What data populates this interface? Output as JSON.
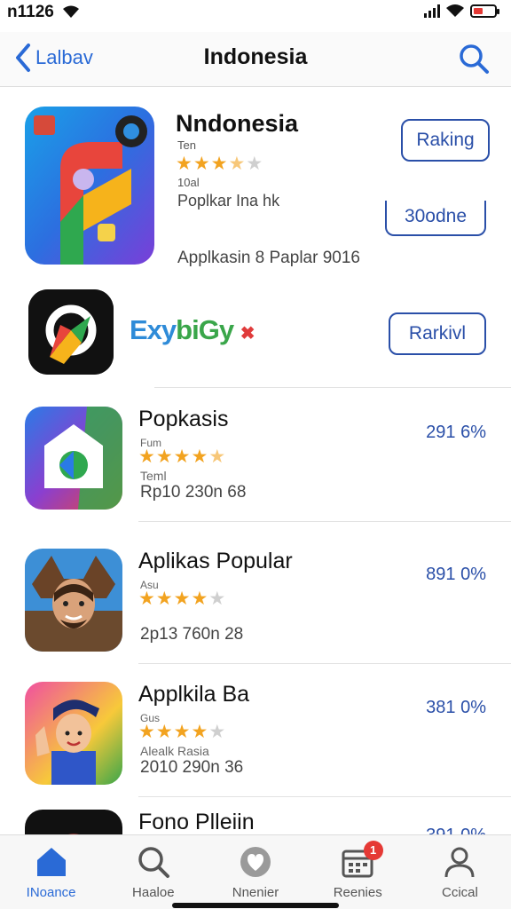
{
  "status_bar": {
    "time": "n1126"
  },
  "nav": {
    "back_label": "Lalbav",
    "title": "Indonesia"
  },
  "featured": {
    "title": "Nndonesia",
    "sub1": "Ten",
    "rating": 3.5,
    "sub2": "10al",
    "description": "Poplkar Ina hk",
    "caption": "Applkasin 8 Paplar 9016",
    "button1": "Raking",
    "button2": "30odne"
  },
  "promo": {
    "logo_part1": "Exy",
    "logo_part2": "biGy",
    "logo_mark": "✖",
    "button": "Rarkivl"
  },
  "list": [
    {
      "title": "Popkasis",
      "sub1": "Fum",
      "rating": 4.5,
      "sub2": "Teml",
      "meta": "Rp10 230n 68",
      "value": "291 6%"
    },
    {
      "title": "Aplikas Popular",
      "sub1": "Asu",
      "rating": 4,
      "sub2": "",
      "meta": "2p13 760n 28",
      "value": "891 0%"
    },
    {
      "title": "Applkila Ba",
      "sub1": "Gus",
      "rating": 4,
      "sub2": "Alealk Rasia",
      "meta": "2010 290n 36",
      "value": "381 0%"
    },
    {
      "title": "Fono Plleiin",
      "sub1": "",
      "rating": 0,
      "sub2": "",
      "meta": "",
      "value": "391 0%"
    }
  ],
  "tabs": [
    {
      "label": "INoance",
      "icon": "home-icon"
    },
    {
      "label": "Haaloe",
      "icon": "search-icon"
    },
    {
      "label": "Nnenier",
      "icon": "heart-icon"
    },
    {
      "label": "Reenies",
      "icon": "calendar-icon",
      "badge": "1"
    },
    {
      "label": "Ccical",
      "icon": "person-icon"
    }
  ],
  "colors": {
    "accent": "#2a6ad6",
    "button_border": "#2a4fa8",
    "star": "#f2a320",
    "badge": "#e53935"
  }
}
